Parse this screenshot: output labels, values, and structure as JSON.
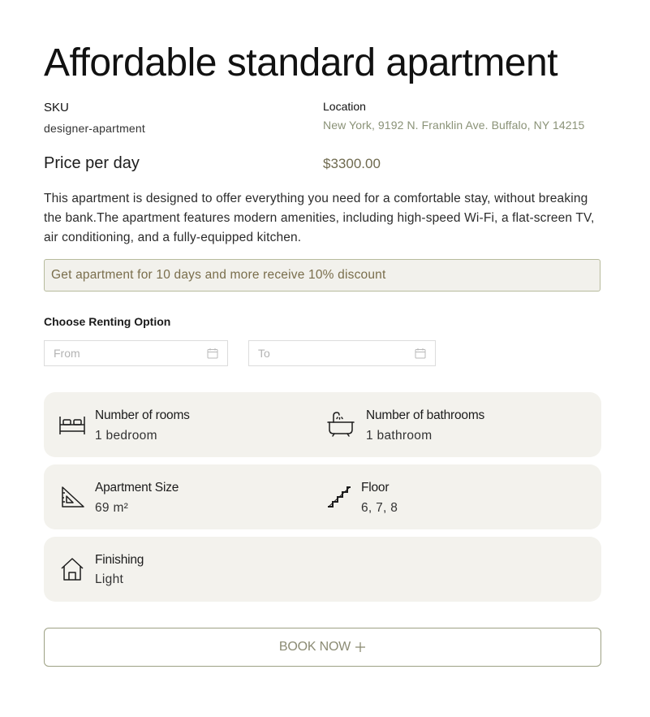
{
  "product": {
    "title": "Affordable standard apartment",
    "sku_label": "SKU",
    "sku_value": "designer-apartment",
    "location_label": "Location",
    "location_value": "New York, 9192 N. Franklin Ave. Buffalo, NY 14215",
    "price_label": "Price per day",
    "price_value": "$3300.00",
    "description": "This apartment is designed to offer everything you need for a comfortable stay, without breaking the bank.The apartment features modern amenities, including high-speed Wi-Fi, a flat-screen TV, air conditioning, and a fully-equipped kitchen.",
    "discount_text": "Get apartment for 10 days and more receive 10% discount"
  },
  "renting": {
    "label": "Choose Renting Option",
    "from_placeholder": "From",
    "to_placeholder": "To"
  },
  "features": {
    "rooms": {
      "label": "Number of rooms",
      "value": "1 bedroom",
      "icon": "bed-icon"
    },
    "bathrooms": {
      "label": "Number of bathrooms",
      "value": "1 bathroom",
      "icon": "bathtub-icon"
    },
    "size": {
      "label": "Apartment Size",
      "value": "69 m²",
      "icon": "set-square-icon"
    },
    "floor": {
      "label": "Floor",
      "value": "6, 7, 8",
      "icon": "stairs-icon"
    },
    "finishing": {
      "label": "Finishing",
      "value": "Light",
      "icon": "house-icon"
    }
  },
  "actions": {
    "book_label": "BOOK NOW"
  },
  "colors": {
    "accent_text": "#8a9277",
    "price": "#6f6a4f",
    "discount_bg": "#f2f1ec",
    "discount_border": "#b7bb9c",
    "card_bg": "#f3f2ed",
    "button_border": "#9da184"
  }
}
